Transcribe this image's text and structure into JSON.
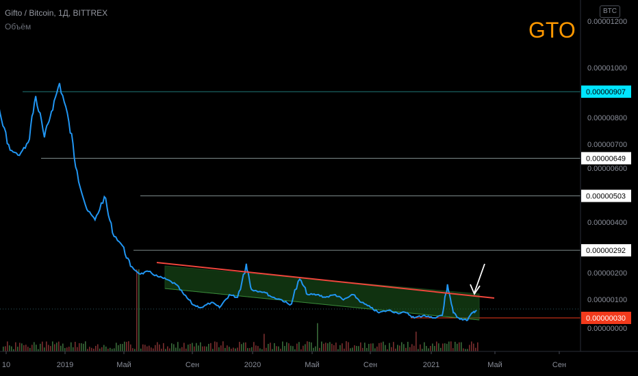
{
  "header": {
    "symbol_line": "Gifto / Bitcoin, 1Д, BITTREX",
    "volume_label": "Объём",
    "ticker": "GTO",
    "currency_badge": "BTC"
  },
  "colors": {
    "price_line": "#2196f3",
    "channel_fill": "#1e5c1e",
    "resistance": "#f0463c",
    "hline": "#8fa3a0",
    "cyan_level": "#00e5ff",
    "current_price_bg": "#f23a1c",
    "ticker": "#ff9800",
    "volume_up": "#3a6b3a",
    "volume_down": "#7a2e2e"
  },
  "chart_data": {
    "type": "line",
    "title": "Gifto / Bitcoin, 1Д, BITTREX",
    "x_axis_labels": [
      "10",
      "2019",
      "Май",
      "Сен",
      "2020",
      "Май",
      "Сен",
      "2021",
      "Май",
      "Сен"
    ],
    "y_axis_labels": [
      "0.00001200",
      "0.00001000",
      "0.00000800",
      "0.00000700",
      "0.00000600",
      "0.00000400",
      "0.00000200",
      "0.00000100",
      "0.00000000"
    ],
    "ylim": [
      -4e-07,
      1.27e-05
    ],
    "horizontal_levels": [
      {
        "value": 9.07e-06,
        "label": "0.00000907",
        "style": "cyan"
      },
      {
        "value": 6.49e-06,
        "label": "0.00000649",
        "style": "white"
      },
      {
        "value": 5.03e-06,
        "label": "0.00000503",
        "style": "white"
      },
      {
        "value": 2.92e-06,
        "label": "0.00000292",
        "style": "white"
      },
      {
        "value": 3e-07,
        "label": "0.00000030",
        "style": "current"
      }
    ],
    "series": [
      {
        "points": [
          [
            "2018-10-10",
            1.17e-05
          ],
          [
            "2018-10-25",
            9.3e-06
          ],
          [
            "2018-11-05",
            1.08e-05
          ],
          [
            "2018-11-20",
            1.06e-05
          ],
          [
            "2018-12-05",
            1.13e-05
          ],
          [
            "2018-12-20",
            9.8e-06
          ],
          [
            "2019-01-05",
            8e-06
          ],
          [
            "2019-01-20",
            6.8e-06
          ],
          [
            "2019-02-05",
            6.6e-06
          ],
          [
            "2019-02-20",
            7.1e-06
          ],
          [
            "2019-03-05",
            8.9e-06
          ],
          [
            "2019-03-20",
            7.3e-06
          ],
          [
            "2019-04-01",
            8.3e-06
          ],
          [
            "2019-04-15",
            9.4e-06
          ],
          [
            "2019-05-01",
            7.9e-06
          ],
          [
            "2019-05-15",
            6e-06
          ],
          [
            "2019-06-01",
            4.5e-06
          ],
          [
            "2019-06-15",
            4.1e-06
          ],
          [
            "2019-07-01",
            5e-06
          ],
          [
            "2019-07-15",
            3.6e-06
          ],
          [
            "2019-08-01",
            3.1e-06
          ],
          [
            "2019-08-15",
            2.3e-06
          ],
          [
            "2019-09-01",
            2e-06
          ],
          [
            "2019-09-15",
            2.1e-06
          ],
          [
            "2019-10-01",
            1.9e-06
          ],
          [
            "2019-10-15",
            1.8e-06
          ],
          [
            "2019-11-01",
            1.6e-06
          ],
          [
            "2019-11-15",
            1.2e-06
          ],
          [
            "2019-12-01",
            8e-07
          ],
          [
            "2019-12-15",
            7e-07
          ],
          [
            "2020-01-01",
            9e-07
          ],
          [
            "2020-01-15",
            7e-07
          ],
          [
            "2020-02-01",
            1.2e-06
          ],
          [
            "2020-02-15",
            1.1e-06
          ],
          [
            "2020-03-01",
            2.4e-06
          ],
          [
            "2020-03-10",
            1.4e-06
          ],
          [
            "2020-04-01",
            1.3e-06
          ],
          [
            "2020-04-15",
            1.1e-06
          ],
          [
            "2020-05-01",
            1e-06
          ],
          [
            "2020-05-15",
            8e-07
          ],
          [
            "2020-06-01",
            1.8e-06
          ],
          [
            "2020-06-15",
            1.2e-06
          ],
          [
            "2020-07-01",
            1.2e-06
          ],
          [
            "2020-07-15",
            1.1e-06
          ],
          [
            "2020-08-01",
            1.2e-06
          ],
          [
            "2020-08-15",
            1e-06
          ],
          [
            "2020-09-01",
            1.2e-06
          ],
          [
            "2020-09-15",
            9e-07
          ],
          [
            "2020-10-01",
            7e-07
          ],
          [
            "2020-10-15",
            5e-07
          ],
          [
            "2020-11-01",
            6e-07
          ],
          [
            "2020-11-15",
            5e-07
          ],
          [
            "2020-12-01",
            5e-07
          ],
          [
            "2020-12-15",
            3e-07
          ],
          [
            "2021-01-01",
            4e-07
          ],
          [
            "2021-01-15",
            3e-07
          ],
          [
            "2021-02-01",
            4e-07
          ],
          [
            "2021-02-10",
            1.6e-06
          ],
          [
            "2021-02-20",
            5e-07
          ],
          [
            "2021-03-01",
            3e-07
          ],
          [
            "2021-03-15",
            2e-07
          ],
          [
            "2021-03-25",
            5e-07
          ],
          [
            "2021-04-01",
            6e-07
          ]
        ]
      }
    ],
    "grid": false
  }
}
